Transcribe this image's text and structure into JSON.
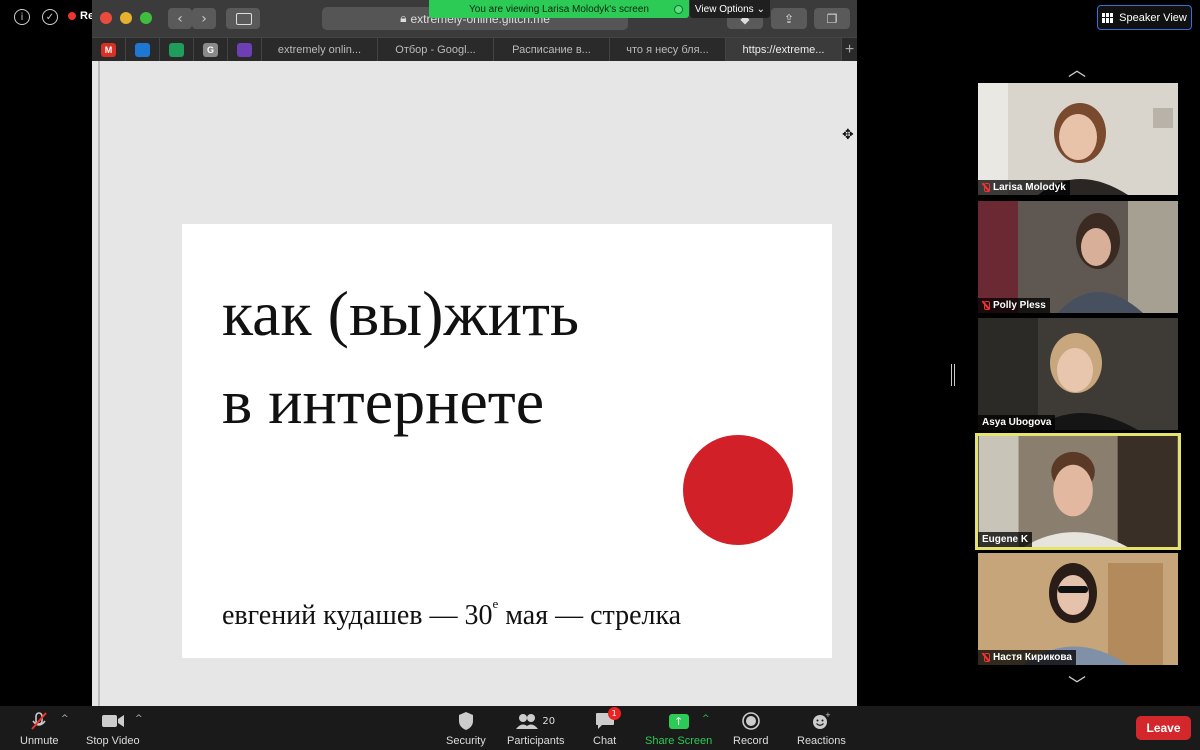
{
  "zoom": {
    "recording_label": "Recording",
    "banner_text": "You are viewing Larisa Molodyk's screen",
    "view_options_label": "View Options",
    "speaker_view_label": "Speaker View"
  },
  "browser": {
    "address": "extremely-online.glitch.me",
    "bookmark_icons": [
      {
        "name": "gmail-icon",
        "glyph": "M",
        "color": "#d93025"
      },
      {
        "name": "trello-icon",
        "glyph": "",
        "color": "#1f77d4"
      },
      {
        "name": "sheets-icon",
        "glyph": "",
        "color": "#1e9e5a"
      },
      {
        "name": "g-icon",
        "glyph": "G",
        "color": "#8a8a8a"
      },
      {
        "name": "forms-icon",
        "glyph": "",
        "color": "#6c3fb5"
      }
    ],
    "tabs": [
      {
        "label": "extremely onlin...",
        "active": false
      },
      {
        "label": "Отбор - Googl...",
        "active": false
      },
      {
        "label": "Расписание в...",
        "active": false
      },
      {
        "label": "что я несу бля...",
        "active": false
      },
      {
        "label": "https://extreme...",
        "active": true
      }
    ]
  },
  "slide": {
    "title_line1": "как (вы)жить",
    "title_line2": "в интернете",
    "subtitle_before": "евгений кудашев — 30",
    "subtitle_sup": "е",
    "subtitle_after": " мая — стрелка",
    "dot_color": "#d22029"
  },
  "participants": [
    {
      "name": "Larisa Molodyk",
      "muted": true,
      "active": false
    },
    {
      "name": "Polly Pless",
      "muted": true,
      "active": false
    },
    {
      "name": "Asya Ubogova",
      "muted": false,
      "active": false
    },
    {
      "name": "Eugene K",
      "muted": false,
      "active": true
    },
    {
      "name": "Настя Кирикова",
      "muted": true,
      "active": false
    }
  ],
  "toolbar": {
    "unmute": "Unmute",
    "stop_video": "Stop Video",
    "security": "Security",
    "participants": "Participants",
    "participants_count": "20",
    "chat": "Chat",
    "chat_badge": "1",
    "share_screen": "Share Screen",
    "record": "Record",
    "reactions": "Reactions",
    "leave": "Leave"
  }
}
